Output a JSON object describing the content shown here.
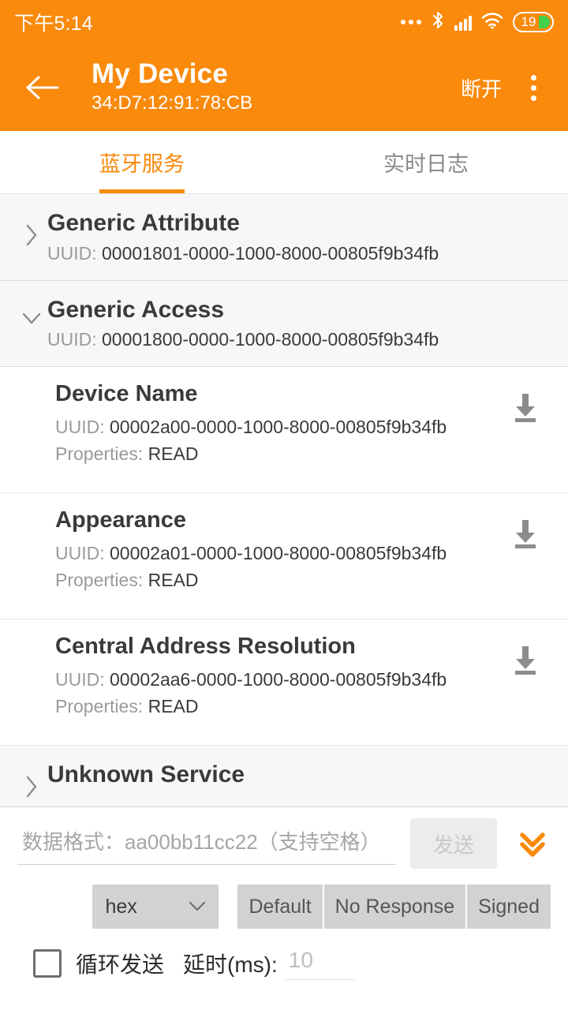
{
  "theme": {
    "accent": "#F98A0C",
    "battery_green": "#43D04A",
    "text_dark": "#3A3A3A",
    "text_muted": "#9A9A9A"
  },
  "statusbar": {
    "time": "下午5:14",
    "icons": [
      "more-dots-icon",
      "bluetooth-icon",
      "signal-icon",
      "wifi-icon",
      "battery-icon"
    ],
    "battery_level": "19"
  },
  "appbar": {
    "back_icon": "arrow-left-icon",
    "title": "My Device",
    "subtitle": "34:D7:12:91:78:CB",
    "action_label": "断开",
    "overflow_icon": "more-vertical-icon"
  },
  "tabs": [
    {
      "label": "蓝牙服务",
      "active": true
    },
    {
      "label": "实时日志",
      "active": false
    }
  ],
  "labels": {
    "uuid_prefix": "UUID: ",
    "props_prefix": "Properties: "
  },
  "services": [
    {
      "name": "Generic Attribute",
      "uuid": "00001801-0000-1000-8000-00805f9b34fb",
      "expanded": false,
      "chevron": "chevron-right-icon",
      "characteristics": []
    },
    {
      "name": "Generic Access",
      "uuid": "00001800-0000-1000-8000-00805f9b34fb",
      "expanded": true,
      "chevron": "chevron-down-icon",
      "characteristics": [
        {
          "name": "Device Name",
          "uuid": "00002a00-0000-1000-8000-00805f9b34fb",
          "properties": "READ",
          "action_icon": "download-icon"
        },
        {
          "name": "Appearance",
          "uuid": "00002a01-0000-1000-8000-00805f9b34fb",
          "properties": "READ",
          "action_icon": "download-icon"
        },
        {
          "name": "Central Address Resolution",
          "uuid": "00002aa6-0000-1000-8000-00805f9b34fb",
          "properties": "READ",
          "action_icon": "download-icon"
        }
      ]
    },
    {
      "name": "Unknown Service",
      "uuid": "",
      "expanded": false,
      "chevron": "chevron-right-icon",
      "characteristics": []
    }
  ],
  "bottom_panel": {
    "input_value": "",
    "input_placeholder": "数据格式：aa00bb11cc22（支持空格）",
    "send_label": "发送",
    "send_disabled": true,
    "expand_icon": "double-chevron-down-icon",
    "format_select": {
      "value": "hex",
      "chevron": "chevron-down-icon"
    },
    "write_modes": [
      "Default",
      "No Response",
      "Signed"
    ],
    "loop": {
      "checked": false,
      "label": "循环发送",
      "delay_label": "延时(ms):",
      "delay_value": "",
      "delay_placeholder": "10"
    }
  }
}
